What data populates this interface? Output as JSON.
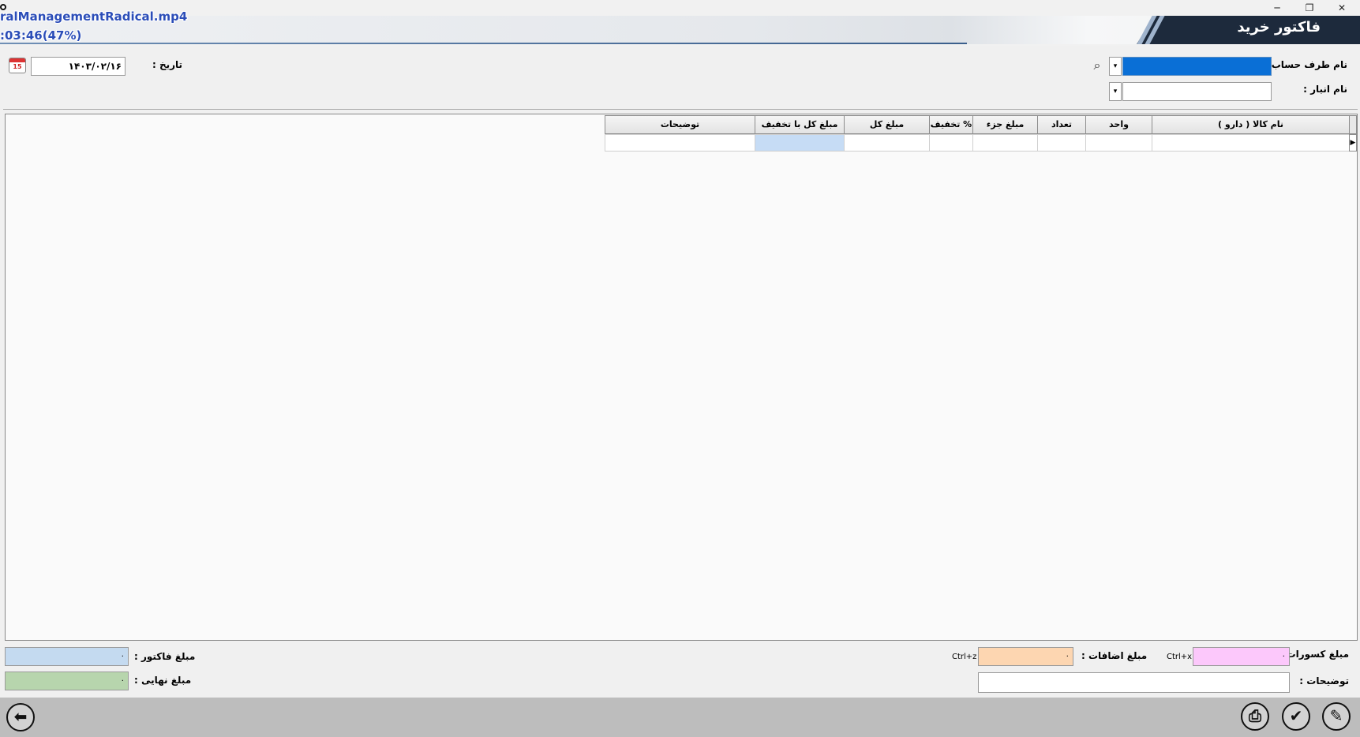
{
  "window": {
    "title": "فاکتور خرید",
    "minimize_glyph": "─",
    "restore_glyph": "❐",
    "close_glyph": "✕"
  },
  "overlay": {
    "filename": "ralManagementRadical.mp4",
    "time": ":03:46(47%)"
  },
  "header": {
    "account_label": "نام طرف حساب :",
    "account_value": "",
    "warehouse_label": "نام انبار :",
    "warehouse_value": "",
    "date_label": "تاریخ :",
    "date_value": "۱۴۰۳/۰۲/۱۶",
    "calendar_badge": "15",
    "dropdown_glyph": "▾",
    "search_glyph": "⌕"
  },
  "grid": {
    "columns": [
      "نام کالا ( دارو )",
      "واحد",
      "تعداد",
      "مبلغ جزء",
      "% تخفیف",
      "مبلغ کل",
      "مبلغ کل با تخفیف",
      "توضیحات"
    ],
    "row_indicator": "▶"
  },
  "footer": {
    "deductions_label": "مبلغ کسورات :",
    "deductions_value": "۰",
    "deductions_shortcut": "Ctrl+x",
    "additions_label": "مبلغ اضافات :",
    "additions_value": "۰",
    "additions_shortcut": "Ctrl+z",
    "description_label": "توضیحات :",
    "description_value": "",
    "invoice_amount_label": "مبلغ فاکتور :",
    "invoice_amount_value": "۰",
    "final_amount_label": "مبلغ نهایی :",
    "final_amount_value": "۰"
  },
  "toolbar": {
    "back_glyph": "⬅",
    "print_glyph": "⎙",
    "confirm_glyph": "✔",
    "edit_glyph": "✎"
  },
  "colors": {
    "account_field_bg": "#0a6fd6",
    "deductions_bg": "#fcc8fb",
    "additions_bg": "#fdd6b1",
    "invoice_amount_bg": "#c4daf0",
    "final_amount_bg": "#b7d5ad",
    "selected_cell_bg": "#c6dcf5"
  }
}
